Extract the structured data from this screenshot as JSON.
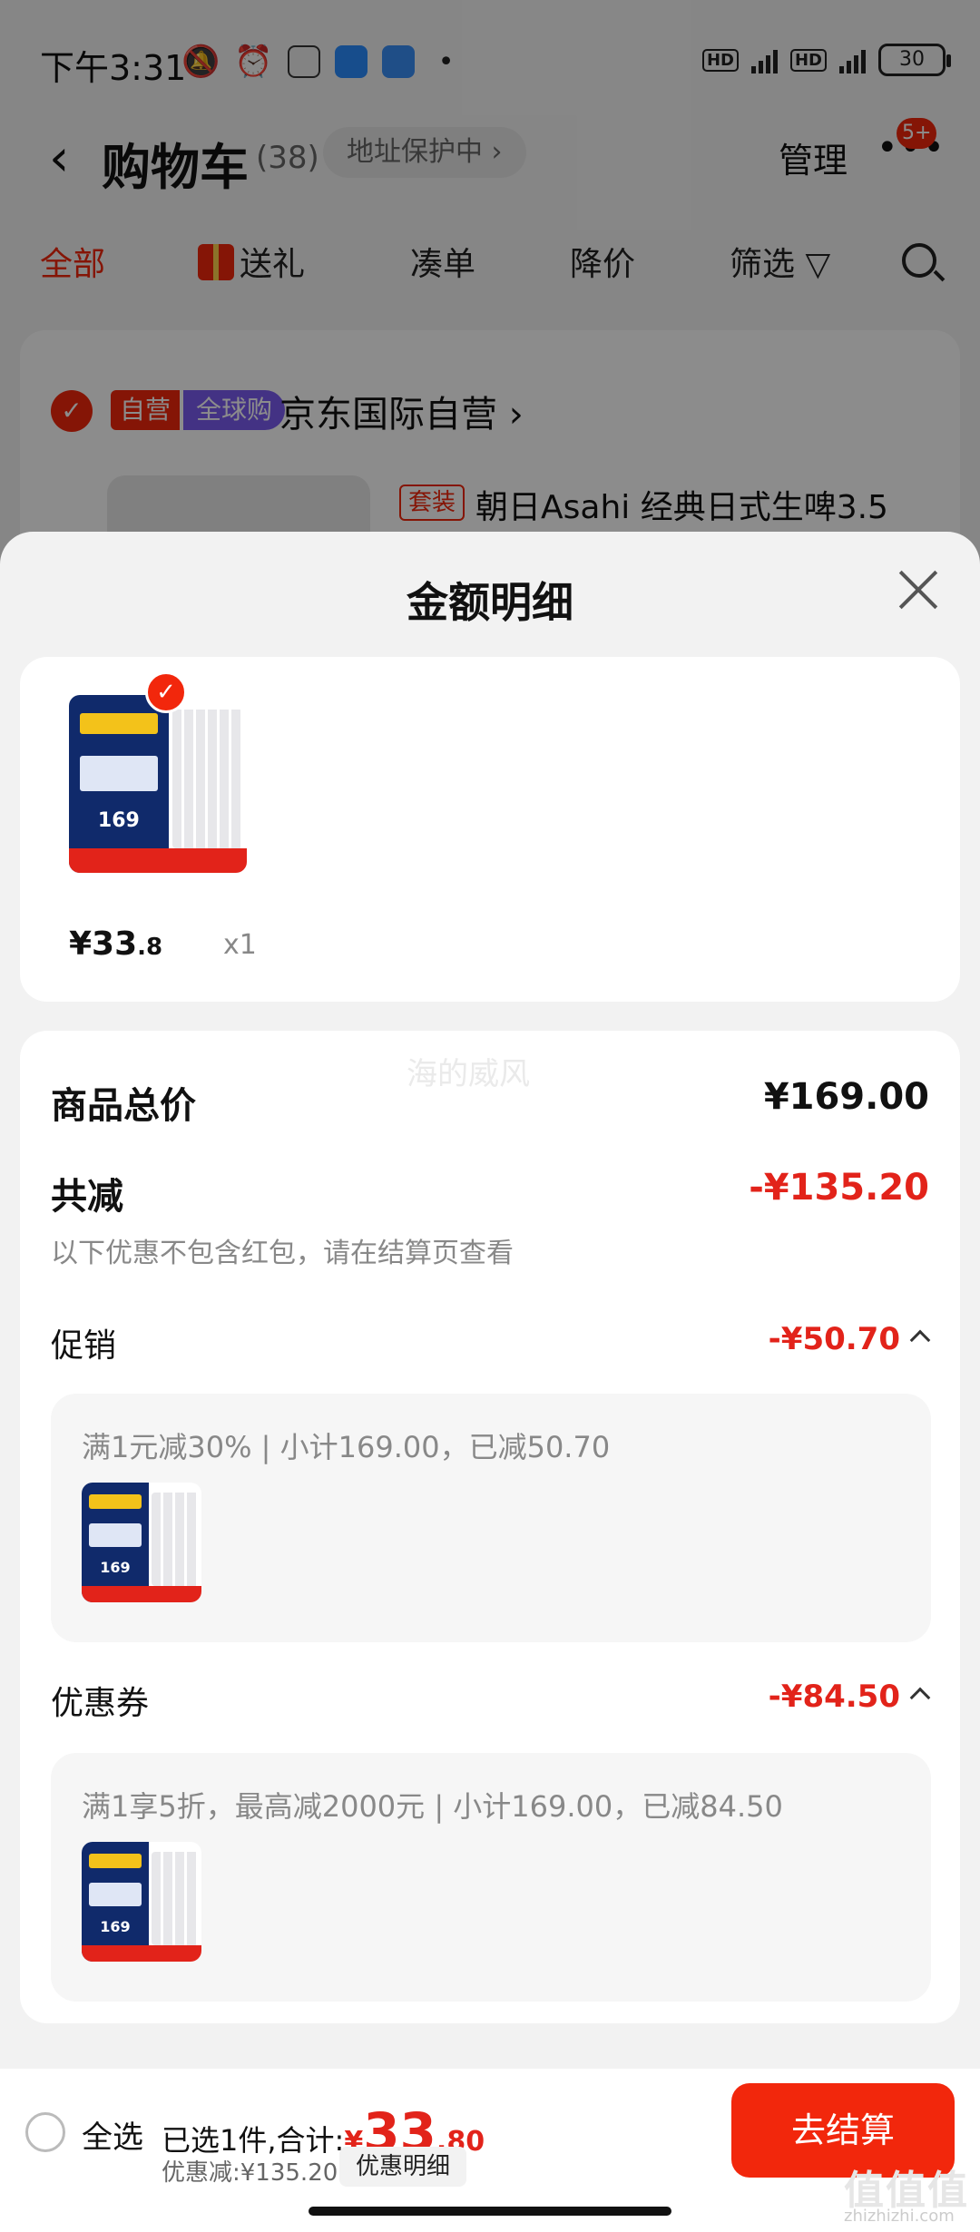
{
  "status_bar": {
    "time": "下午3:31",
    "battery": "30"
  },
  "header": {
    "title": "购物车",
    "count": "(38)",
    "address_pill": "地址保护中 ›",
    "manage": "管理",
    "badge": "5+"
  },
  "tabs": [
    {
      "label": "全部"
    },
    {
      "label": "送礼"
    },
    {
      "label": "凑单"
    },
    {
      "label": "降价"
    },
    {
      "label": "筛选"
    }
  ],
  "store": {
    "tag_ziying": "自营",
    "tag_global": "全球购",
    "name": "京东国际自营 ›",
    "set_tag": "套装",
    "product_title": "朝日Asahi 经典日式生啤3.5"
  },
  "sheet": {
    "title": "金额明细",
    "item": {
      "price_int": "¥33",
      "price_dec": ".8",
      "qty": "x1",
      "img_price": "169"
    },
    "watermark": "海的威风",
    "total_label": "商品总价",
    "total_value": "¥169.00",
    "reduce_label": "共减",
    "reduce_value": "-¥135.20",
    "reduce_note": "以下优惠不包含红包，请在结算页查看",
    "promo": {
      "label": "促销",
      "value": "-¥50.70",
      "detail": "满1元减30% | 小计169.00，已减50.70"
    },
    "coupon": {
      "label": "优惠券",
      "value": "-¥84.50",
      "detail": "满1享5折，最高减2000元 | 小计169.00，已减84.50"
    }
  },
  "bottom_bar": {
    "select_all": "全选",
    "summary_prefix": "已选1件,合计:",
    "total_yen": "¥",
    "total_int": "33",
    "total_dec": ".80",
    "discount": "优惠减:¥135.20",
    "detail_button": "优惠明细",
    "checkout": "去结算",
    "corner_mark": "值值值",
    "corner_sub": "zhizhizhi.com"
  },
  "colors": {
    "accent": "#f2270c",
    "price_red": "#e2231a",
    "global_tag": "#7b5bf0"
  }
}
